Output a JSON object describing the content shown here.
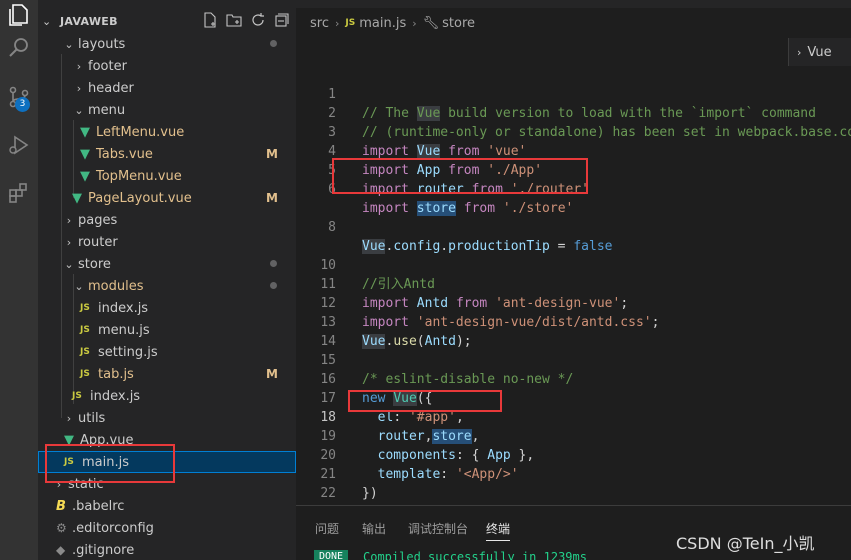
{
  "explorer": {
    "title": "JAVAWEB",
    "tree": [
      {
        "label": "layouts",
        "kind": "folder-open",
        "status": "dot"
      },
      {
        "label": "footer",
        "kind": "folder"
      },
      {
        "label": "header",
        "kind": "folder"
      },
      {
        "label": "menu",
        "kind": "folder-open"
      },
      {
        "label": "LeftMenu.vue",
        "kind": "vue",
        "modified": true
      },
      {
        "label": "Tabs.vue",
        "kind": "vue",
        "status": "M",
        "modified": true
      },
      {
        "label": "TopMenu.vue",
        "kind": "vue",
        "modified": true
      },
      {
        "label": "PageLayout.vue",
        "kind": "vue",
        "status": "M",
        "modified": true
      },
      {
        "label": "pages",
        "kind": "folder"
      },
      {
        "label": "router",
        "kind": "folder"
      },
      {
        "label": "store",
        "kind": "folder-open",
        "status": "dot"
      },
      {
        "label": "modules",
        "kind": "folder-open",
        "status": "dot"
      },
      {
        "label": "index.js",
        "kind": "js"
      },
      {
        "label": "menu.js",
        "kind": "js"
      },
      {
        "label": "setting.js",
        "kind": "js"
      },
      {
        "label": "tab.js",
        "kind": "js",
        "status": "M",
        "modified": true
      },
      {
        "label": "index.js",
        "kind": "js"
      },
      {
        "label": "utils",
        "kind": "folder"
      },
      {
        "label": "App.vue",
        "kind": "vue"
      },
      {
        "label": "main.js",
        "kind": "js",
        "selected": true
      },
      {
        "label": "static",
        "kind": "folder"
      },
      {
        "label": ".babelrc",
        "kind": "babel"
      },
      {
        "label": ".editorconfig",
        "kind": "gear"
      },
      {
        "label": ".gitignore",
        "kind": "dot"
      }
    ],
    "js_badge": "JS"
  },
  "activity": {
    "scm_badge": "3"
  },
  "breadcrumb": {
    "part1": "src",
    "part2": "main.js",
    "part3": "store",
    "js_badge": "JS"
  },
  "sticky": {
    "label": "Vue"
  },
  "code": {
    "line_numbers": [
      "1",
      "2",
      "3",
      "4",
      "5",
      "6",
      "",
      "8",
      "",
      "10",
      "11",
      "12",
      "13",
      "14",
      "15",
      "16",
      "17",
      "18",
      "19",
      "20",
      "21",
      "22"
    ],
    "lines": [
      "// The Vue build version to load with the `import` command",
      "// (runtime-only or standalone) has been set in webpack.base.conf",
      "import Vue from 'vue'",
      "import App from './App'",
      "import router from './router'",
      "import store from './store'",
      "",
      "Vue.config.productionTip = false",
      "",
      "//引入Antd",
      "import Antd from 'ant-design-vue';",
      "import 'ant-design-vue/dist/antd.css';",
      "Vue.use(Antd);",
      "",
      "/* eslint-disable no-new */",
      "new Vue({",
      "  el: '#app',",
      "  router,store,",
      "  components: { App },",
      "  template: '<App/>'",
      "})",
      ""
    ]
  },
  "panel": {
    "tabs": [
      "问题",
      "输出",
      "调试控制台",
      "终端"
    ],
    "done": "DONE",
    "message": "Compiled successfully in 1239ms"
  },
  "watermark": "CSDN @TeIn_小凯"
}
